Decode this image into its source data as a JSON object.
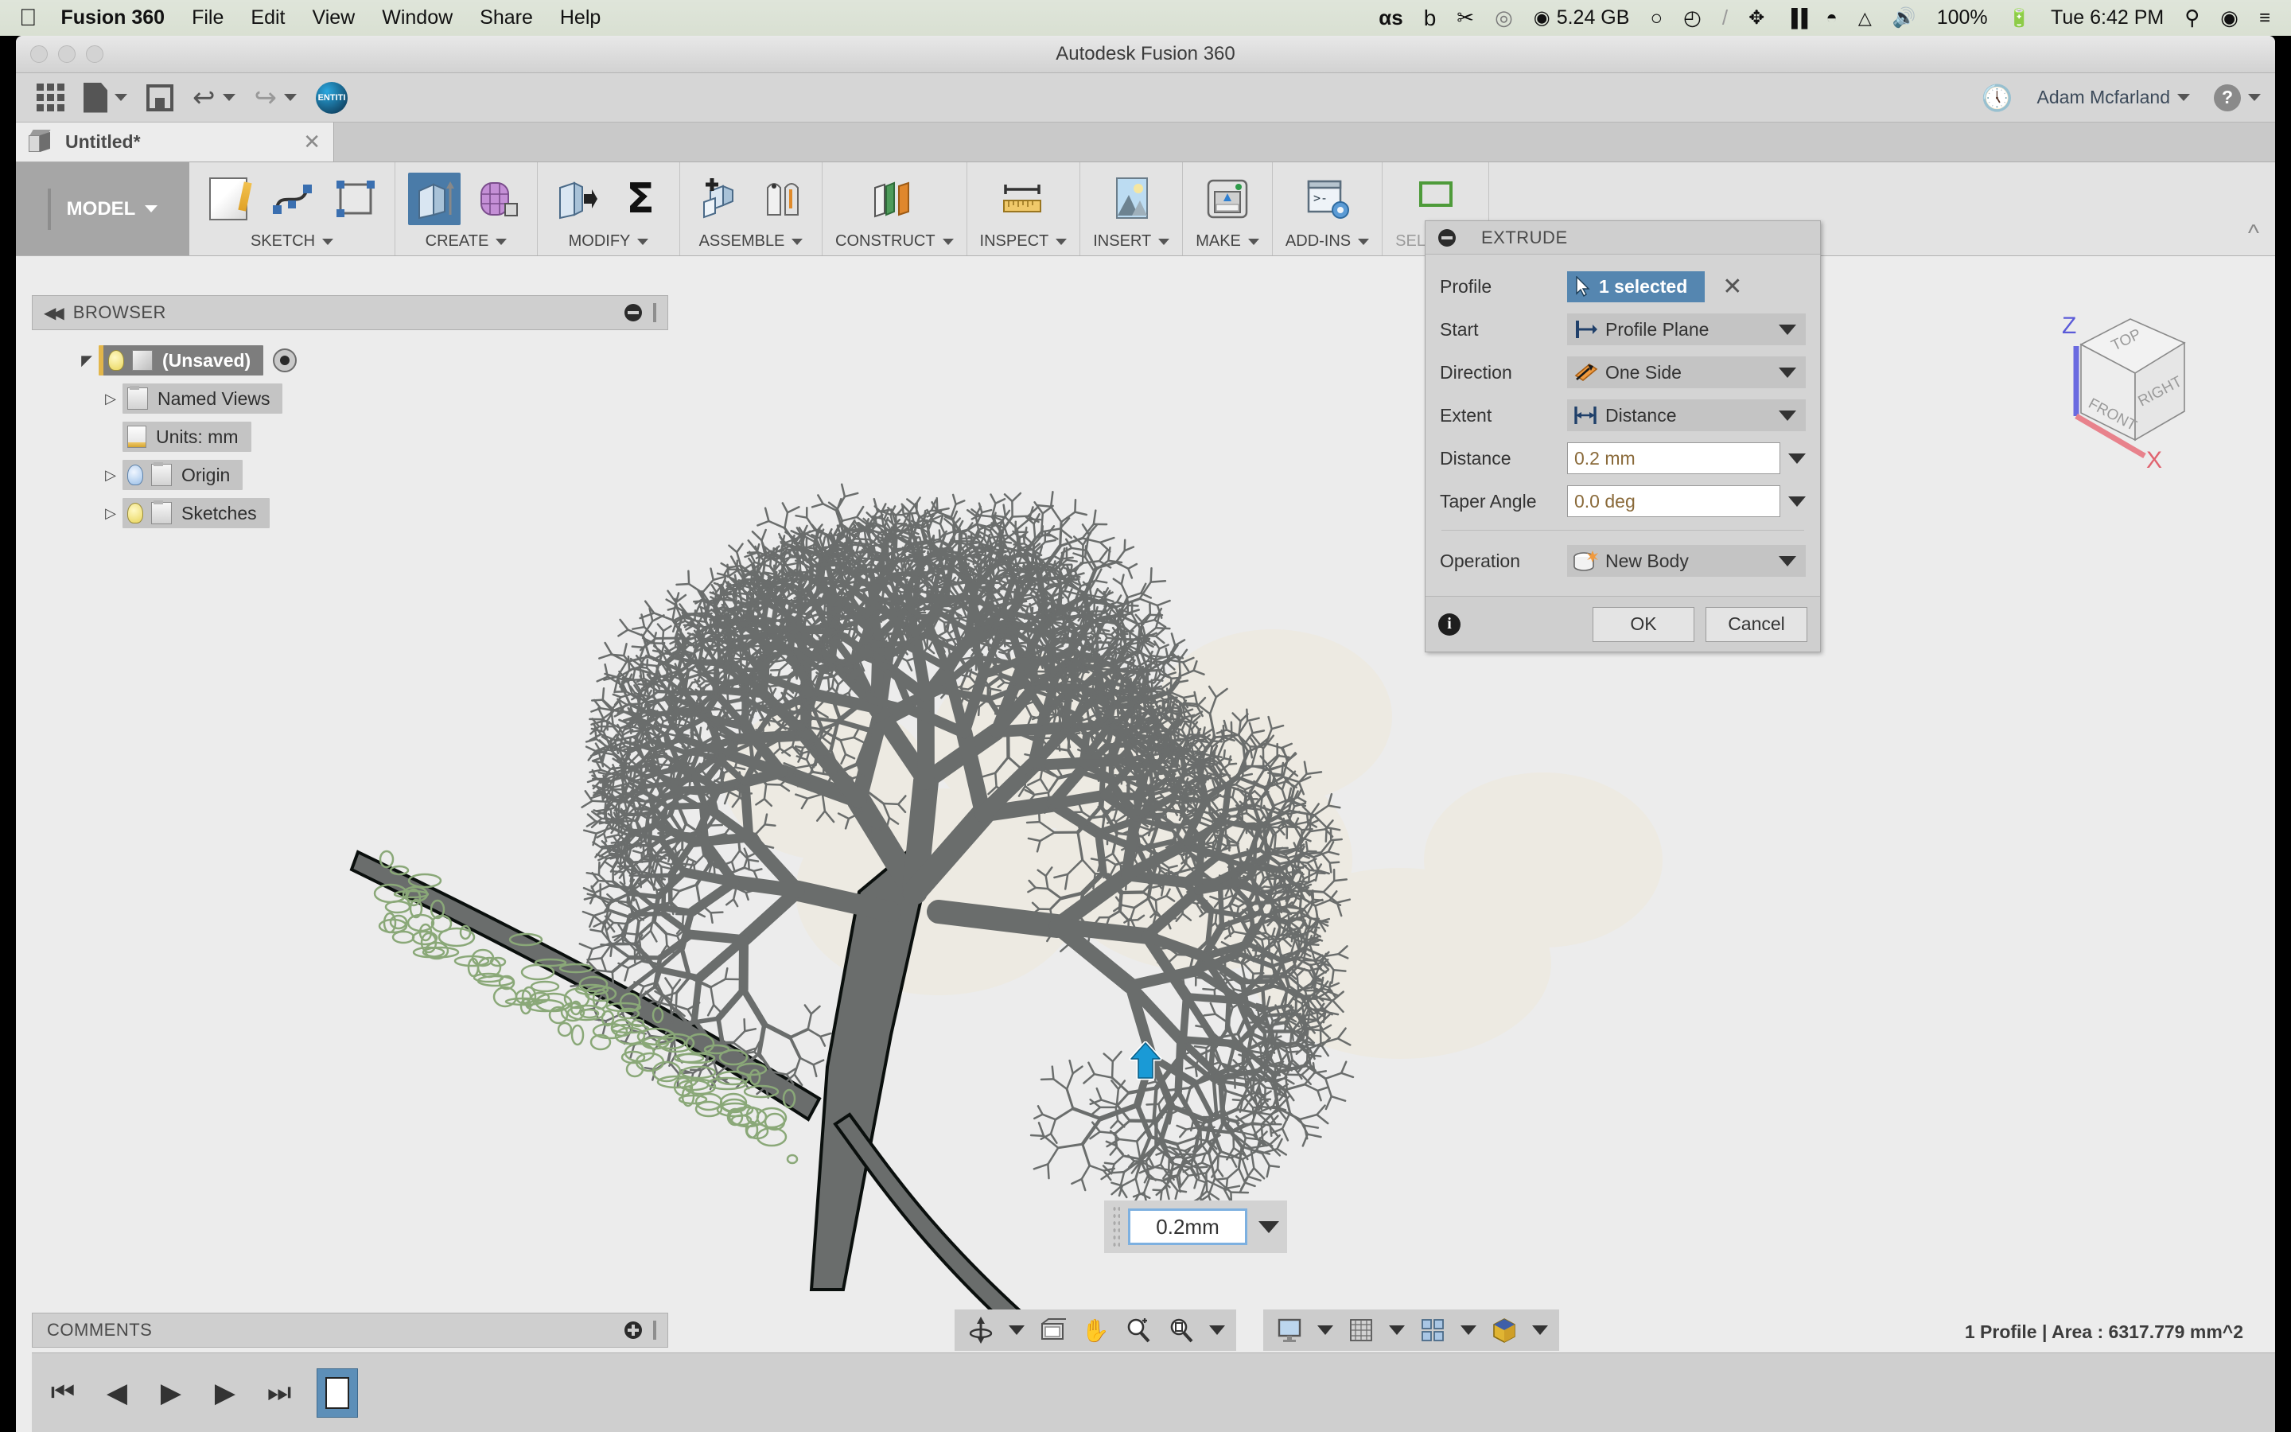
{
  "macbar": {
    "apple_glyph": "&#63743;",
    "app_name": "Fusion 360",
    "menus": [
      "File",
      "Edit",
      "View",
      "Window",
      "Share",
      "Help"
    ],
    "status_items": [
      {
        "name": "os-icon",
        "text": "αs"
      },
      {
        "name": "b-icon",
        "text": "b"
      },
      {
        "name": "scissors-icon",
        "text": "✂"
      },
      {
        "name": "swirl-icon",
        "text": "◎"
      },
      {
        "name": "disk-usage",
        "text": "5.24 GB"
      },
      {
        "name": "circle-arrow-icon",
        "text": "○"
      },
      {
        "name": "history-clock-icon",
        "text": "◴"
      },
      {
        "name": "slash-icon",
        "text": "/"
      },
      {
        "name": "bluetooth-icon",
        "text": "☰"
      },
      {
        "name": "battery-bars-icon",
        "text": "▐▐"
      },
      {
        "name": "wifi-icon",
        "text": "◠"
      },
      {
        "name": "airplay-icon",
        "text": "△"
      },
      {
        "name": "volume-icon",
        "text": "◀))"
      },
      {
        "name": "battery-percent",
        "text": "100%"
      },
      {
        "name": "battery-icon",
        "text": "▄"
      },
      {
        "name": "clock",
        "text": "Tue 6:42 PM"
      },
      {
        "name": "spotlight-icon",
        "text": "⌕"
      },
      {
        "name": "siri-icon",
        "text": "◉"
      },
      {
        "name": "notification-center-icon",
        "text": "≡"
      }
    ]
  },
  "window": {
    "title": "Autodesk Fusion 360"
  },
  "appbar": {
    "show_data_panel": "grid-icon",
    "file_label": "file-icon",
    "save_label": "save-icon",
    "undo_label": "undo-icon",
    "redo_label": "redo-icon",
    "entiti_label": "ENTITI",
    "job_status_label": "clock-icon",
    "user_name": "Adam Mcfarland",
    "help_label": "?"
  },
  "tab": {
    "title": "Untitled*",
    "close": "✕"
  },
  "ribbon": {
    "workspace": "MODEL",
    "groups": [
      {
        "name": "sketch",
        "label": "SKETCH"
      },
      {
        "name": "create",
        "label": "CREATE"
      },
      {
        "name": "modify",
        "label": "MODIFY"
      },
      {
        "name": "assemble",
        "label": "ASSEMBLE"
      },
      {
        "name": "construct",
        "label": "CONSTRUCT"
      },
      {
        "name": "inspect",
        "label": "INSPECT"
      },
      {
        "name": "insert",
        "label": "INSERT"
      },
      {
        "name": "make",
        "label": "MAKE"
      },
      {
        "name": "addins",
        "label": "ADD-INS"
      },
      {
        "name": "select",
        "label": "SELECT"
      }
    ]
  },
  "browser": {
    "header": "BROWSER",
    "tree": [
      {
        "label": "(Unsaved)",
        "level": 0,
        "expanded": true,
        "active": true,
        "icon": "lightbulb-cube"
      },
      {
        "label": "Named Views",
        "level": 1,
        "expanded": false,
        "active": false,
        "icon": "folder"
      },
      {
        "label": "Units: mm",
        "level": 1,
        "expanded": null,
        "active": false,
        "icon": "document-ruler"
      },
      {
        "label": "Origin",
        "level": 1,
        "expanded": false,
        "active": false,
        "icon": "lightbulb-folder-blue"
      },
      {
        "label": "Sketches",
        "level": 1,
        "expanded": false,
        "active": false,
        "icon": "lightbulb-folder-sketch"
      }
    ]
  },
  "extrude": {
    "title": "EXTRUDE",
    "rows": [
      {
        "name": "profile",
        "label": "Profile",
        "type": "select-badge",
        "value": "1 selected"
      },
      {
        "name": "start",
        "label": "Start",
        "type": "dropdown",
        "value": "Profile Plane"
      },
      {
        "name": "direction",
        "label": "Direction",
        "type": "dropdown",
        "value": "One Side"
      },
      {
        "name": "extent",
        "label": "Extent",
        "type": "dropdown",
        "value": "Distance"
      },
      {
        "name": "distance",
        "label": "Distance",
        "type": "input",
        "value": "0.2 mm"
      },
      {
        "name": "taper-angle",
        "label": "Taper Angle",
        "type": "input",
        "value": "0.0 deg"
      },
      {
        "name": "operation",
        "label": "Operation",
        "type": "dropdown",
        "value": "New Body"
      }
    ],
    "ok": "OK",
    "cancel": "Cancel",
    "info": "i"
  },
  "canvas": {
    "dimension_input_value": "0.2mm",
    "manipulator": "blue-up-arrow",
    "viewcube": {
      "top": "TOP",
      "front": "FRONT",
      "right": "RIGHT",
      "axis_z": "Z",
      "axis_x": "X",
      "z_color": "#5a5ad8",
      "x_color": "#e06a75"
    },
    "colors": {
      "background": "#ececec",
      "sketch_fill": "#edeae2",
      "branch_fill": "#6a6d6c",
      "branch_stroke": "#0a0f0d",
      "unselected_profile": "#8aa878",
      "accent_blue": "#1a9ad6"
    }
  },
  "comments": {
    "header": "COMMENTS"
  },
  "status": {
    "right_text": "1 Profile | Area : 6317.779 mm^2"
  },
  "navbar": {
    "group1": [
      {
        "name": "orbit-icon",
        "glyph": "⥁",
        "caret": true
      },
      {
        "name": "look-at-icon",
        "glyph": "❐",
        "caret": false
      },
      {
        "name": "pan-icon",
        "glyph": "✋",
        "caret": false
      },
      {
        "name": "zoom-icon",
        "glyph": "⌕",
        "caret": false
      },
      {
        "name": "fit-icon",
        "glyph": "⌕",
        "caret": true
      }
    ],
    "group2": [
      {
        "name": "display-settings-icon",
        "glyph": "⬜",
        "caret": true
      },
      {
        "name": "grid-snaps-icon",
        "glyph": "▦",
        "caret": true
      },
      {
        "name": "viewports-icon",
        "glyph": "⊞",
        "caret": true
      },
      {
        "name": "component-color-icon",
        "glyph": "◈",
        "caret": true
      }
    ]
  },
  "timeline": {
    "buttons": [
      "⏮",
      "◀▏",
      "▶",
      "▏▶",
      "⏭"
    ],
    "feature": "sketch-feature"
  }
}
